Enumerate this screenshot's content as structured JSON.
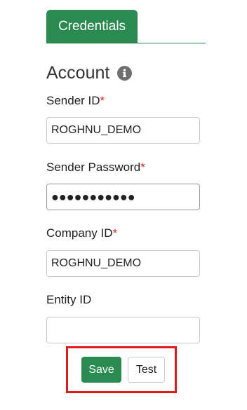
{
  "tabs": [
    {
      "label": "Credentials"
    }
  ],
  "section": {
    "title": "Account",
    "info_icon": "info-circle-icon"
  },
  "fields": {
    "sender_id": {
      "label": "Sender ID",
      "required_mark": "*",
      "value": "ROGHNU_DEMO"
    },
    "sender_password": {
      "label": "Sender Password",
      "required_mark": "*",
      "value": "●●●●●●●●●●●"
    },
    "company_id": {
      "label": "Company ID",
      "required_mark": "*",
      "value": "ROGHNU_DEMO"
    },
    "entity_id": {
      "label": "Entity ID",
      "value": ""
    }
  },
  "actions": {
    "save_label": "Save",
    "test_label": "Test"
  },
  "colors": {
    "accent": "#2a8a4f",
    "required": "#d62d2d",
    "highlight": "#e01a1a"
  }
}
